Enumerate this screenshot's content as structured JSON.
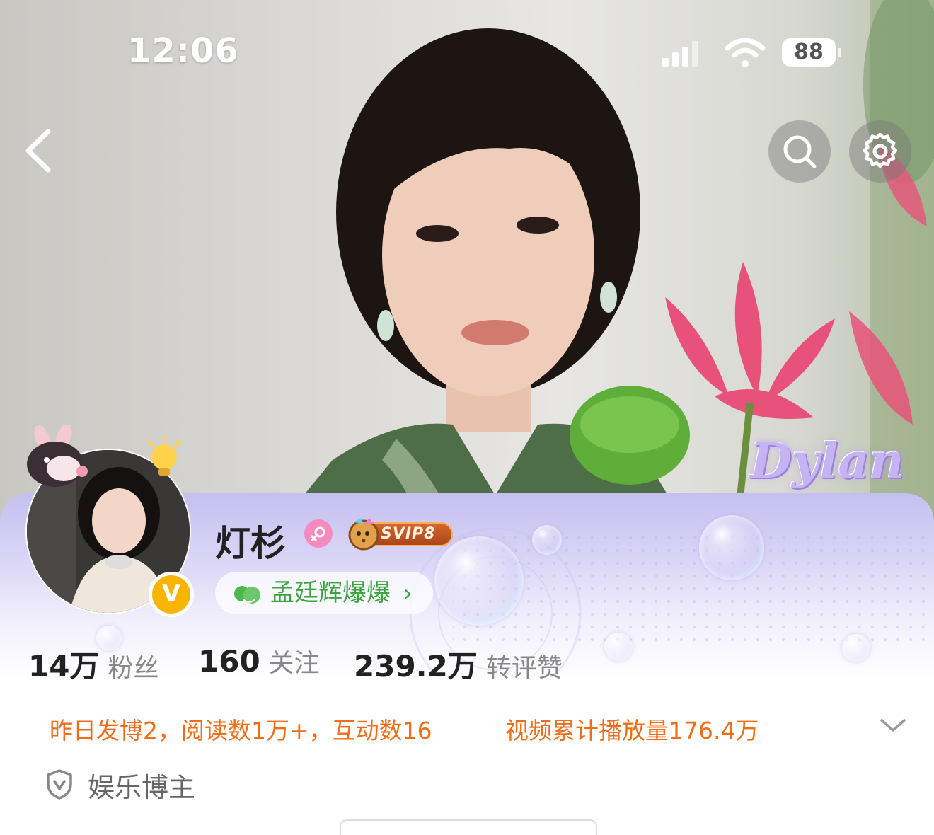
{
  "status_bar": {
    "time": "12:06",
    "battery": "88"
  },
  "cover": {
    "tag": "Dylan"
  },
  "profile": {
    "name": "灯杉",
    "svip": "SVIP8",
    "fan_club": "孟廷辉爆爆",
    "verified": "V"
  },
  "stats": [
    {
      "value": "14万",
      "label": "粉丝"
    },
    {
      "value": "160",
      "label": "关注"
    },
    {
      "value": "239.2万",
      "label": "转评赞"
    }
  ],
  "activity": {
    "left": "昨日发博2，阅读数1万+，互动数16",
    "right": "视频累计播放量176.4万"
  },
  "category": "娱乐博主",
  "colors": {
    "accent_orange": "#f06d17",
    "fan_green": "#3aa33f",
    "verified_gold": "#f7b400"
  },
  "icons": [
    "back-icon",
    "search-icon",
    "settings-icon",
    "gender-female-icon",
    "cookie-icon",
    "fan-club-icon",
    "chevron-down-icon",
    "shield-icon"
  ]
}
